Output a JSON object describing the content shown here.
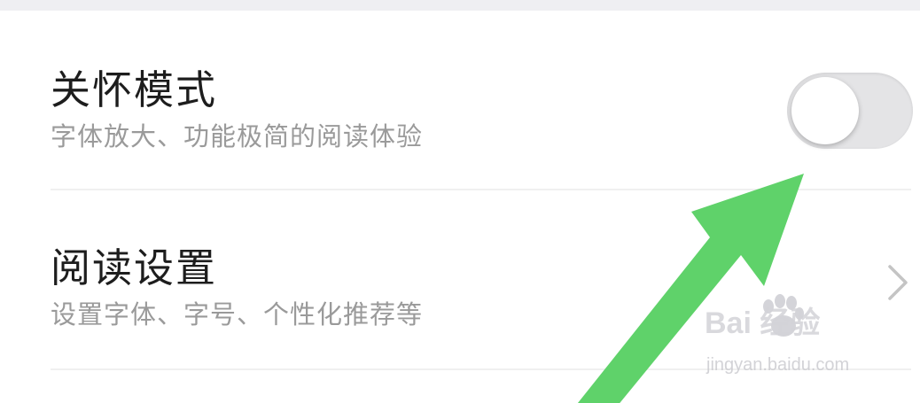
{
  "settings": {
    "care_mode": {
      "title": "关怀模式",
      "subtitle": "字体放大、功能极简的阅读体验",
      "toggle_on": false
    },
    "reading_settings": {
      "title": "阅读设置",
      "subtitle": "设置字体、字号、个性化推荐等"
    }
  },
  "annotation": {
    "arrow_color": "#5fd26a"
  },
  "watermark": {
    "brand": "Bai  经验",
    "url": "jingyan.baidu.com"
  },
  "colors": {
    "title": "#1d1d1d",
    "subtitle": "#9a9a9a",
    "toggle_track_off": "#e4e4e6"
  }
}
